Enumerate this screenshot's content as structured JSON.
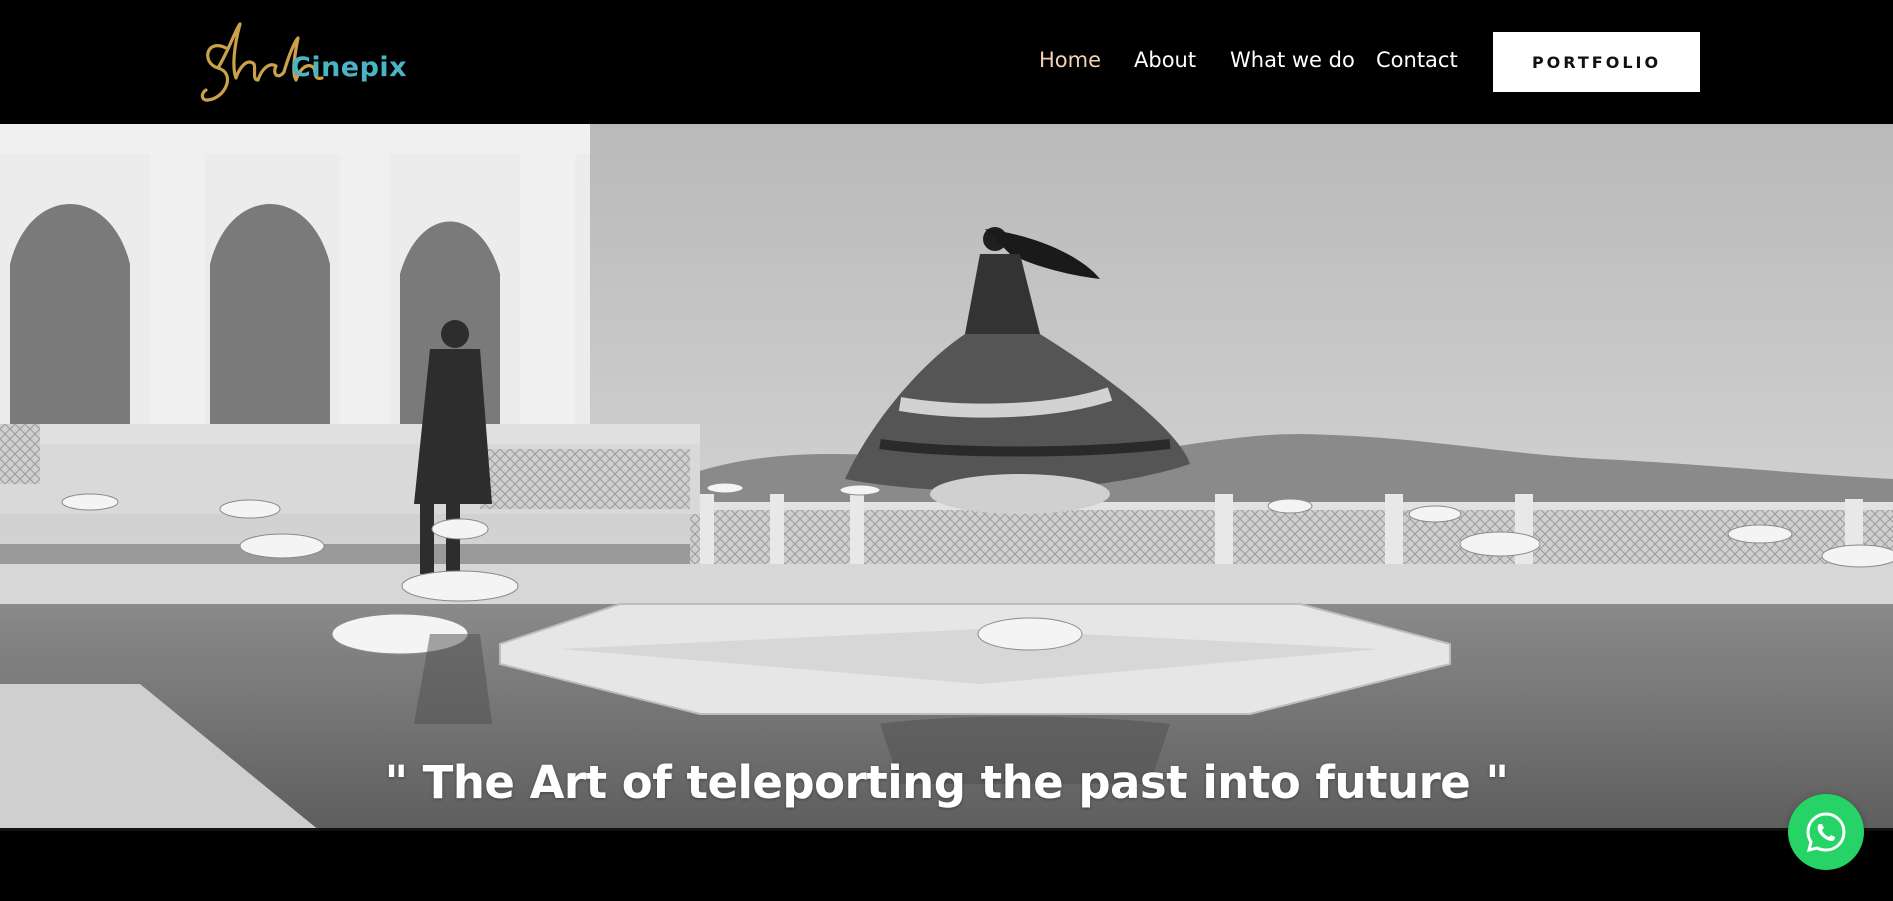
{
  "brand": {
    "script_text": "Shah",
    "name": "Cinepix",
    "accent_color": "#49b5c4",
    "script_color": "#c9a24a"
  },
  "nav": {
    "items": [
      {
        "label": "Home",
        "active": true
      },
      {
        "label": "About",
        "active": false
      },
      {
        "label": "What we do",
        "active": false
      },
      {
        "label": "Contact",
        "active": false
      }
    ],
    "active_color": "#f3d1b4"
  },
  "cta": {
    "portfolio_label": "PORTFOLIO"
  },
  "hero": {
    "quote": "\" The Art of teleporting the past into future \"",
    "image_desc": "black-and-white"
  },
  "floating": {
    "whatsapp_icon": "whatsapp-icon",
    "color": "#25d366"
  }
}
